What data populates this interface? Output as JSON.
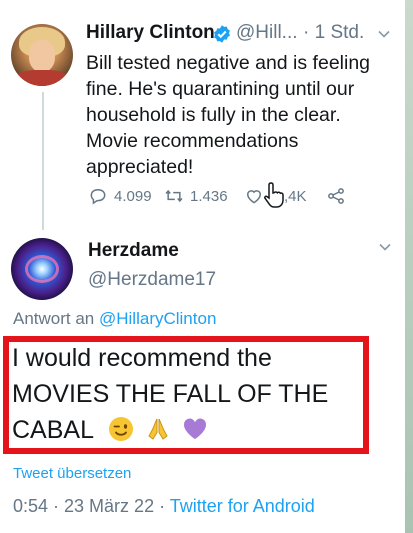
{
  "tweet1": {
    "author_name": "Hillary Clinton",
    "handle": "@Hill...",
    "time": "· 1 Std.",
    "lines": [
      "Bill tested negative and is feeling",
      "fine. He's quarantining until our",
      "household is fully in the clear.",
      "Movie recommendations",
      "appreciated!"
    ],
    "replies": "4.099",
    "retweets": "1.436",
    "likes": ",4K"
  },
  "tweet2": {
    "author_name": "Herzdame",
    "handle": "@Herzdame17",
    "reply_prefix": "Antwort an",
    "reply_mention": "@HillaryClinton",
    "lines": [
      "I would recommend the",
      "MOVIES THE FALL OF THE",
      "CABAL"
    ],
    "translate_label": "Tweet übersetzen",
    "timestamp": "0:54 · 23 März 22 · ",
    "source": "Twitter for Android"
  },
  "colors": {
    "link": "#1da1f2",
    "secondary_text": "#657786",
    "highlight_box": "#e5141b"
  }
}
